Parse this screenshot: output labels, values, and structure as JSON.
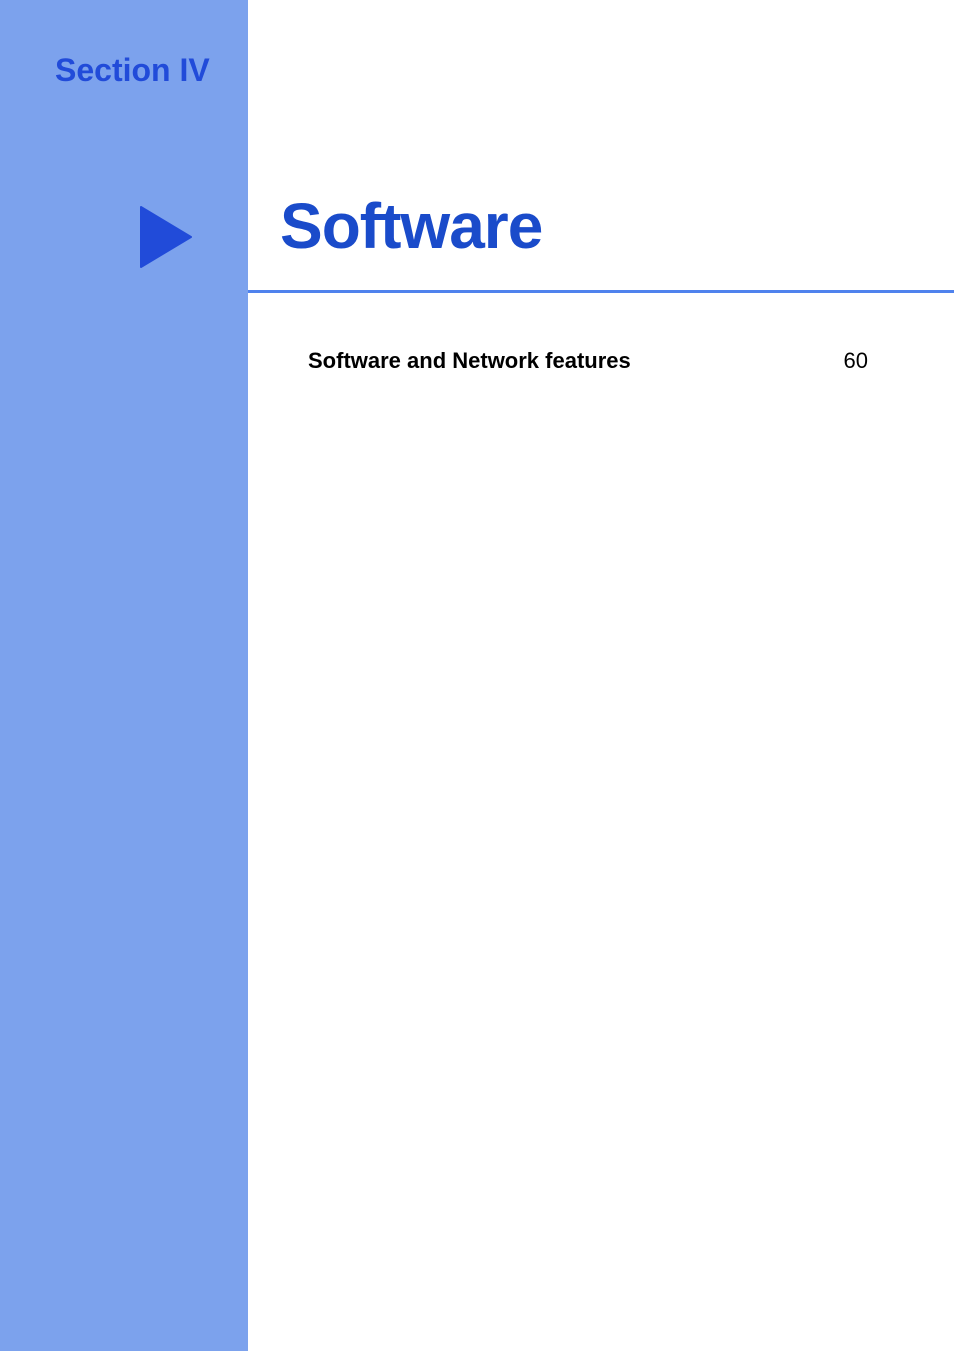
{
  "section": {
    "label": "Section IV"
  },
  "title": "Software",
  "toc": {
    "items": [
      {
        "label": "Software and Network features",
        "page": "60"
      }
    ]
  }
}
